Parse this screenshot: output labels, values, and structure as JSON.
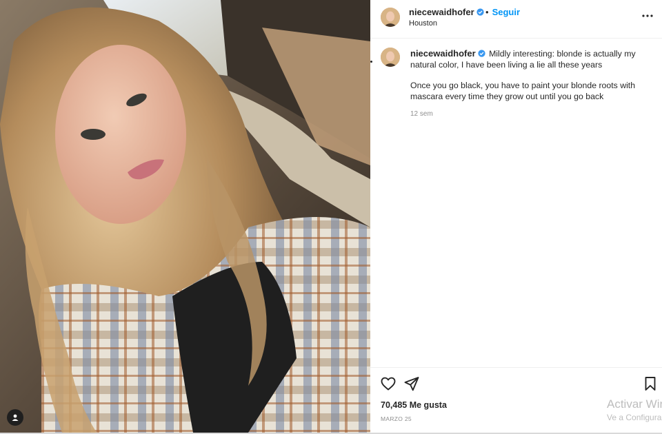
{
  "post": {
    "author": "niecewaidhofer",
    "follow_label": "Seguir",
    "dot": "•",
    "location": "Houston",
    "caption_p1": "Mildly interesting: blonde is actually my natural color, I have been living a lie all these years",
    "caption_p2": "Once you go black, you have to paint your blonde roots with mascara every time they grow out until you go back",
    "time_ago": "12 sem",
    "likes_count": "70,485",
    "likes_label": "Me gusta",
    "date": "MARZO 25"
  },
  "system": {
    "activate_title": "Activar Wir",
    "activate_sub": "Ve a Configura"
  },
  "colors": {
    "accent": "#0095f6",
    "verified": "#3897f0",
    "text": "#262626",
    "muted": "#8e8e8e"
  },
  "icons": [
    "user-tag-icon",
    "verified-badge-icon",
    "more-options-icon",
    "heart-icon",
    "share-icon",
    "bookmark-icon"
  ]
}
